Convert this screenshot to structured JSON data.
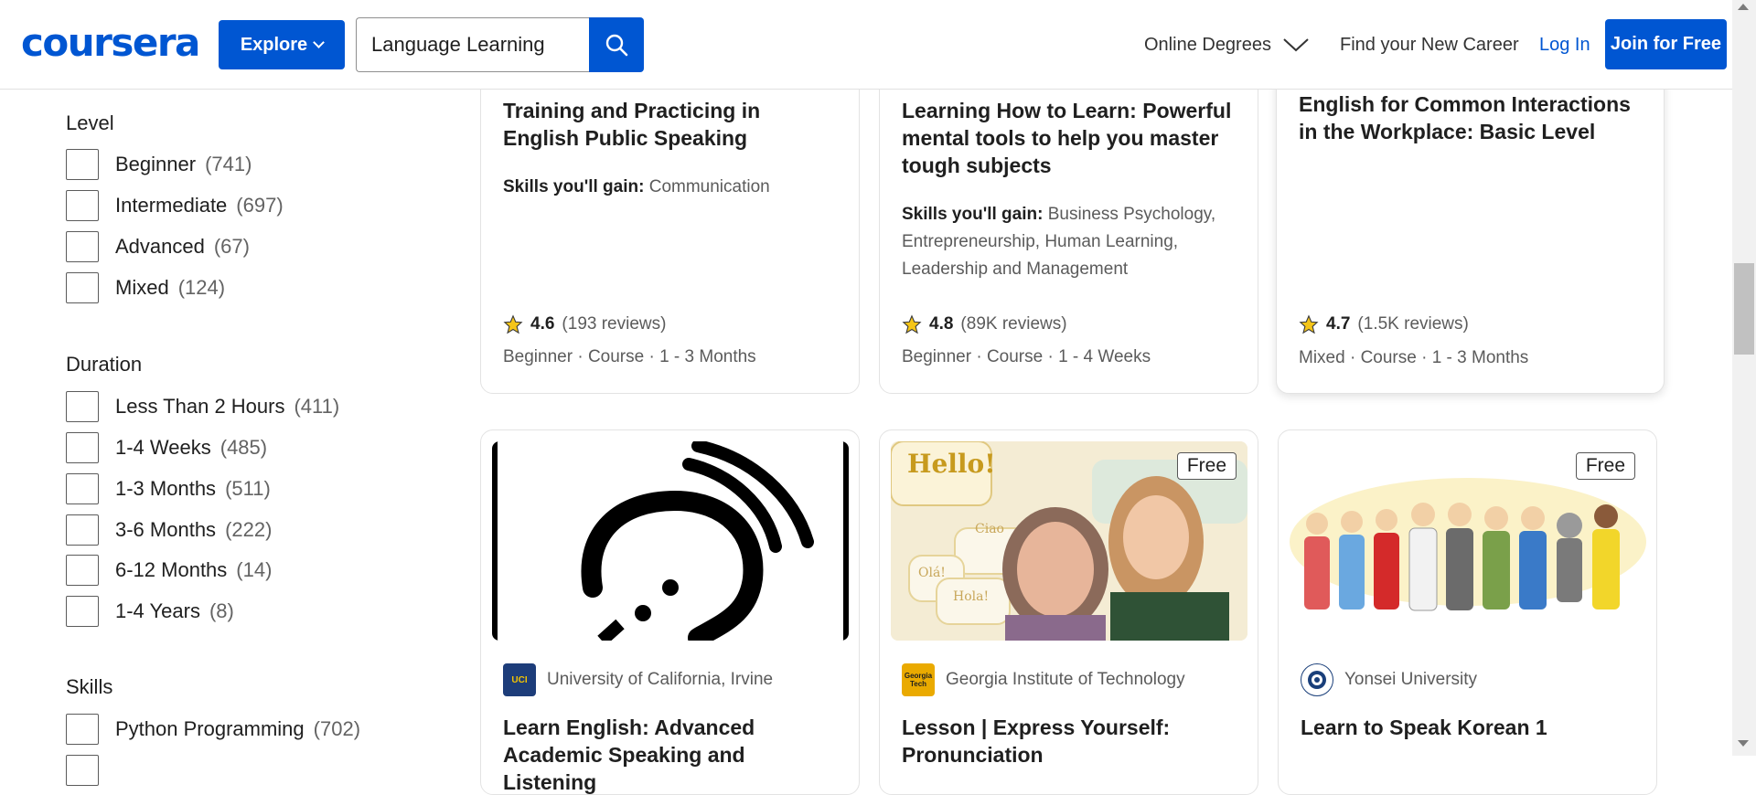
{
  "header": {
    "logo": "coursera",
    "explore_label": "Explore",
    "search_value": "Language Learning",
    "nav_degrees": "Online Degrees",
    "nav_career": "Find your New Career",
    "login": "Log In",
    "join": "Join for Free"
  },
  "filters": {
    "level": {
      "title": "Level",
      "options": [
        {
          "label": "Beginner",
          "count": "(741)"
        },
        {
          "label": "Intermediate",
          "count": "(697)"
        },
        {
          "label": "Advanced",
          "count": "(67)"
        },
        {
          "label": "Mixed",
          "count": "(124)"
        }
      ]
    },
    "duration": {
      "title": "Duration",
      "options": [
        {
          "label": "Less Than 2 Hours",
          "count": "(411)"
        },
        {
          "label": "1-4 Weeks",
          "count": "(485)"
        },
        {
          "label": "1-3 Months",
          "count": "(511)"
        },
        {
          "label": "3-6 Months",
          "count": "(222)"
        },
        {
          "label": "6-12 Months",
          "count": "(14)"
        },
        {
          "label": "1-4 Years",
          "count": "(8)"
        }
      ]
    },
    "skills": {
      "title": "Skills",
      "options": [
        {
          "label": "Python Programming",
          "count": "(702)"
        }
      ]
    }
  },
  "cards_top": [
    {
      "title": "Training and Practicing in English Public Speaking",
      "skills_label": "Skills you'll gain:",
      "skills": "Communication",
      "rating": "4.6",
      "reviews": "(193 reviews)",
      "meta": "Beginner · Course · 1 - 3 Months"
    },
    {
      "title": "Learning How to Learn: Powerful mental tools to help you master tough subjects",
      "skills_label": "Skills you'll gain:",
      "skills": "Business Psychology, Entrepreneurship, Human Learning, Leadership and Management",
      "rating": "4.8",
      "reviews": "(89K reviews)",
      "meta": "Beginner · Course · 1 - 4 Weeks"
    },
    {
      "title": "English for Common Interactions in the Workplace: Basic Level",
      "rating": "4.7",
      "reviews": "(1.5K reviews)",
      "meta": "Mixed · Course · 1 - 3 Months"
    }
  ],
  "cards_bottom": [
    {
      "partner": "University of California, Irvine",
      "partner_logo": "UCI",
      "title": "Learn English: Advanced Academic Speaking and Listening"
    },
    {
      "partner": "Georgia Institute of Technology",
      "partner_logo": "Georgia Tech",
      "title": "Lesson | Express Yourself: Pronunciation",
      "badge": "Free",
      "image_text": {
        "hello": "Hello!",
        "ola": "Olá!",
        "hola": "Hola!",
        "ciao": "Ciao"
      }
    },
    {
      "partner": "Yonsei University",
      "title": "Learn to Speak Korean 1",
      "badge": "Free"
    }
  ],
  "colors": {
    "brand": "#0056d2",
    "star": "#f5c518"
  }
}
